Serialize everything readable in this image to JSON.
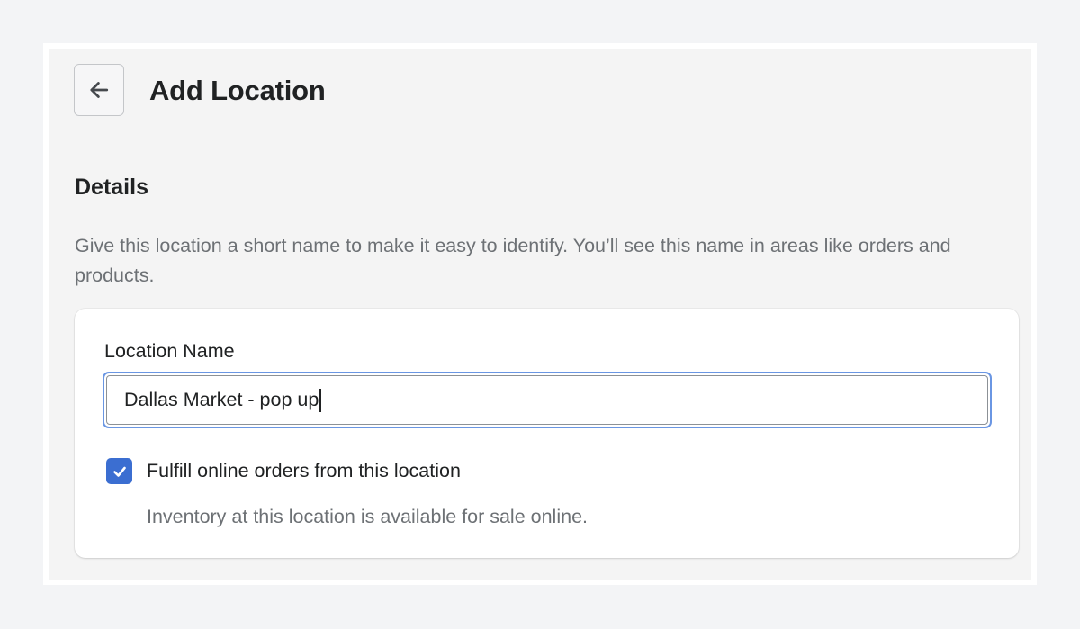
{
  "header": {
    "title": "Add Location",
    "back_icon": "arrow-left-icon"
  },
  "details": {
    "heading": "Details",
    "description": "Give this location a short name to make it easy to identify. You’ll see this name in areas like orders and products."
  },
  "form": {
    "location_name_label": "Location Name",
    "location_name_value": "Dallas Market - pop up",
    "fulfill_checkbox": {
      "checked": true,
      "label": "Fulfill online orders from this location",
      "help_text": "Inventory at this location is available for sale online."
    }
  },
  "colors": {
    "page_background": "#f4f4f4",
    "accent": "#3b6ed1",
    "focus_ring": "#6a96e3",
    "muted_text": "#6d7175",
    "primary_text": "#202223"
  }
}
